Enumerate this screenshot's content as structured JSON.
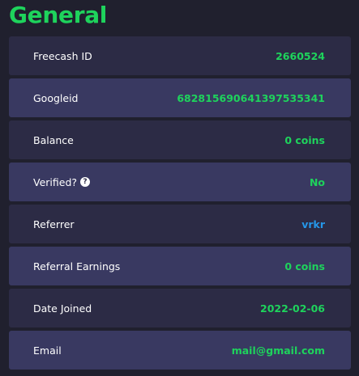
{
  "section": {
    "title": "General"
  },
  "rows": [
    {
      "label": "Freecash ID",
      "value": "2660524"
    },
    {
      "label": "Googleid",
      "value": "682815690641397535341"
    },
    {
      "label": "Balance",
      "value": "0 coins"
    },
    {
      "label": "Verified?",
      "help_icon": "question-mark",
      "value": "No"
    },
    {
      "label": "Referrer",
      "value": "vrkr"
    },
    {
      "label": "Referral Earnings",
      "value": "0 coins"
    },
    {
      "label": "Date Joined",
      "value": "2022-02-06"
    },
    {
      "label": "Email",
      "value": "mail@gmail.com"
    }
  ],
  "colors": {
    "accent_green": "#1ed35c",
    "link_blue": "#2596e8",
    "background": "#20202e",
    "row_dark": "#2c2b45",
    "row_light": "#393961"
  }
}
